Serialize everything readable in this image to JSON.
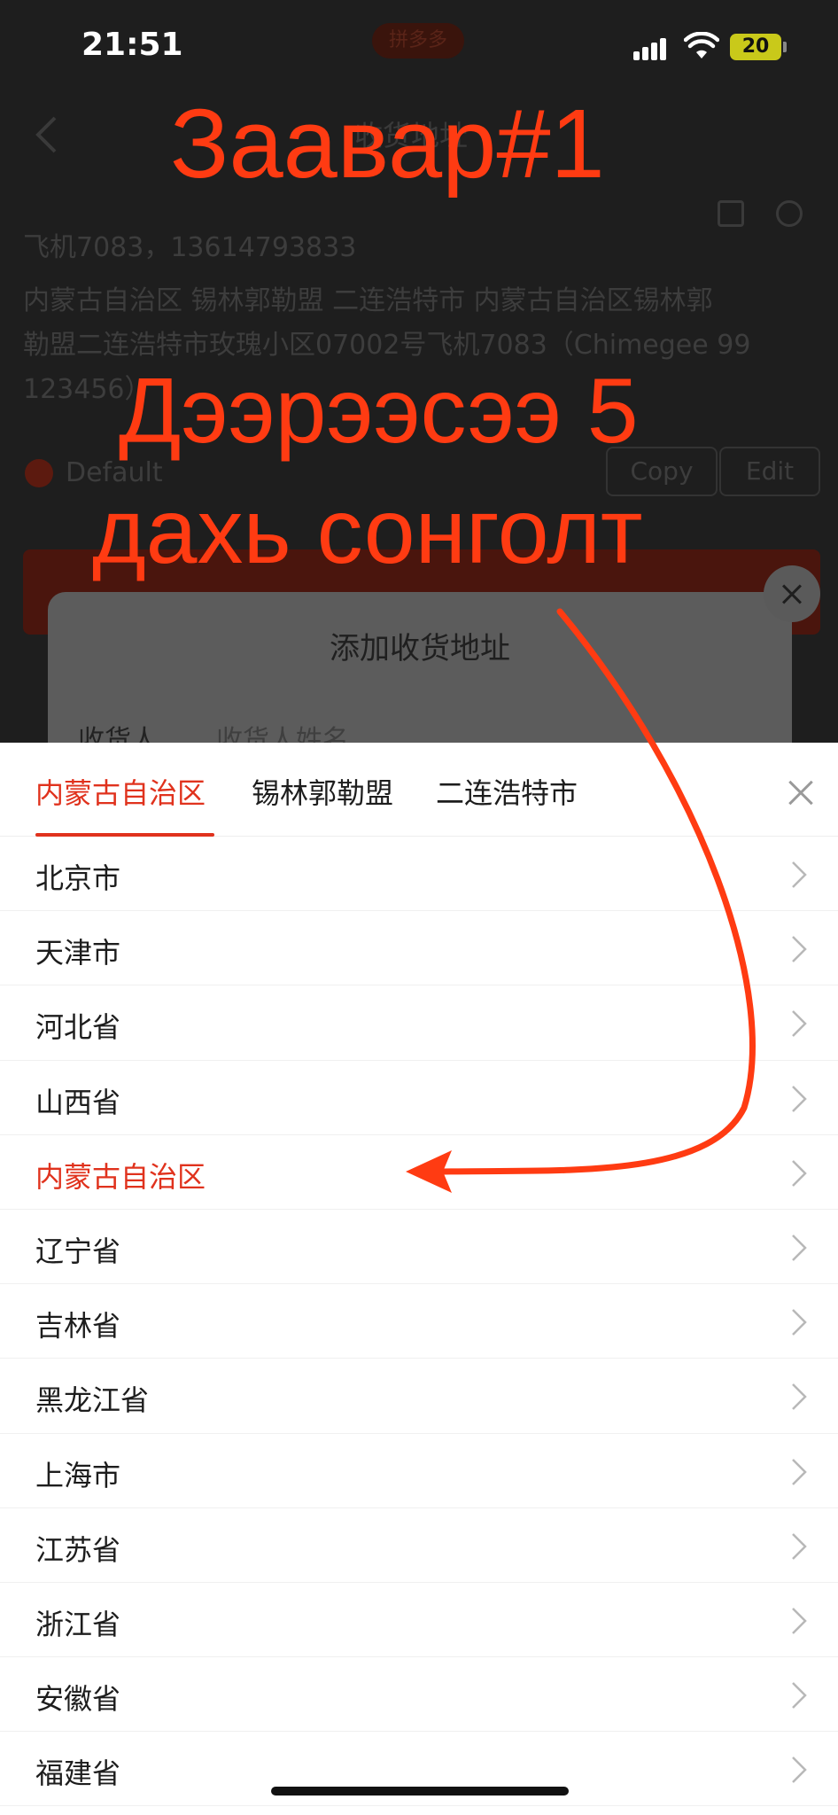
{
  "status_bar": {
    "time": "21:51",
    "pill_label": "拼多多",
    "battery": "20"
  },
  "background_page": {
    "title": "收货地址",
    "recipient_line": "飞机7083，13614793833",
    "address_lines": [
      "内蒙古自治区 锡林郭勒盟 二连浩特市 内蒙古自治区锡林郭",
      "勒盟二连浩特市玫瑰小区07002号飞机7083（Chimegee 99",
      "123456）"
    ],
    "default_label": "Default",
    "copy_button": "Copy",
    "edit_button": "Edit"
  },
  "modal": {
    "title": "添加收货地址",
    "recipient_label": "收货人",
    "recipient_placeholder": "收货人姓名"
  },
  "picker": {
    "tabs": [
      "内蒙古自治区",
      "锡林郭勒盟",
      "二连浩特市"
    ],
    "active_tab_index": 0,
    "selected_index": 4,
    "accent_color": "#e0321d",
    "items": [
      "北京市",
      "天津市",
      "河北省",
      "山西省",
      "内蒙古自治区",
      "辽宁省",
      "吉林省",
      "黑龙江省",
      "上海市",
      "江苏省",
      "浙江省",
      "安徽省",
      "福建省"
    ]
  },
  "overlay": {
    "color": "#ff3b12",
    "heading": "Заавар#1",
    "line1": "Дээрээсээ 5",
    "line2": "дахь сонголт"
  }
}
